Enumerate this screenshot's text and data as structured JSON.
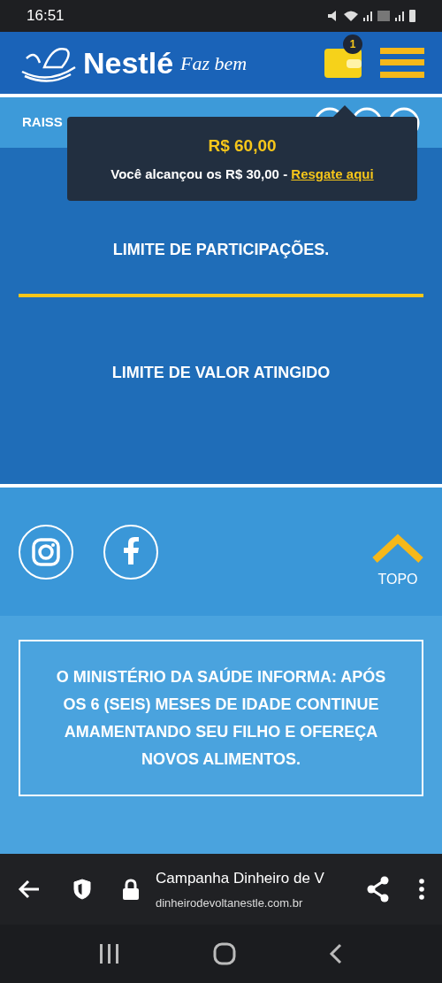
{
  "status_bar": {
    "time": "16:51"
  },
  "header": {
    "brand": "Nestlé",
    "tagline": "Faz bem",
    "wallet_badge": "1"
  },
  "user_bar": {
    "name": "RAISS"
  },
  "tooltip": {
    "amount": "R$ 60,00",
    "message": "Você alcançou os R$ 30,00 - ",
    "link": "Resgate aqui"
  },
  "notice": {
    "line_1": "LIMITE DE PARTICIPAÇÕES.",
    "line_2": "LIMITE DE VALOR ATINGIDO"
  },
  "footer": {
    "top_label": "TOPO",
    "health_notice": "O MINISTÉRIO DA SAÚDE INFORMA: APÓS OS 6 (SEIS) MESES DE IDADE CONTINUE AMAMENTANDO SEU FILHO E OFEREÇA NOVOS ALIMENTOS."
  },
  "browser": {
    "title": "Campanha Dinheiro de V",
    "url": "dinheirodevoltanestle.com.br"
  }
}
